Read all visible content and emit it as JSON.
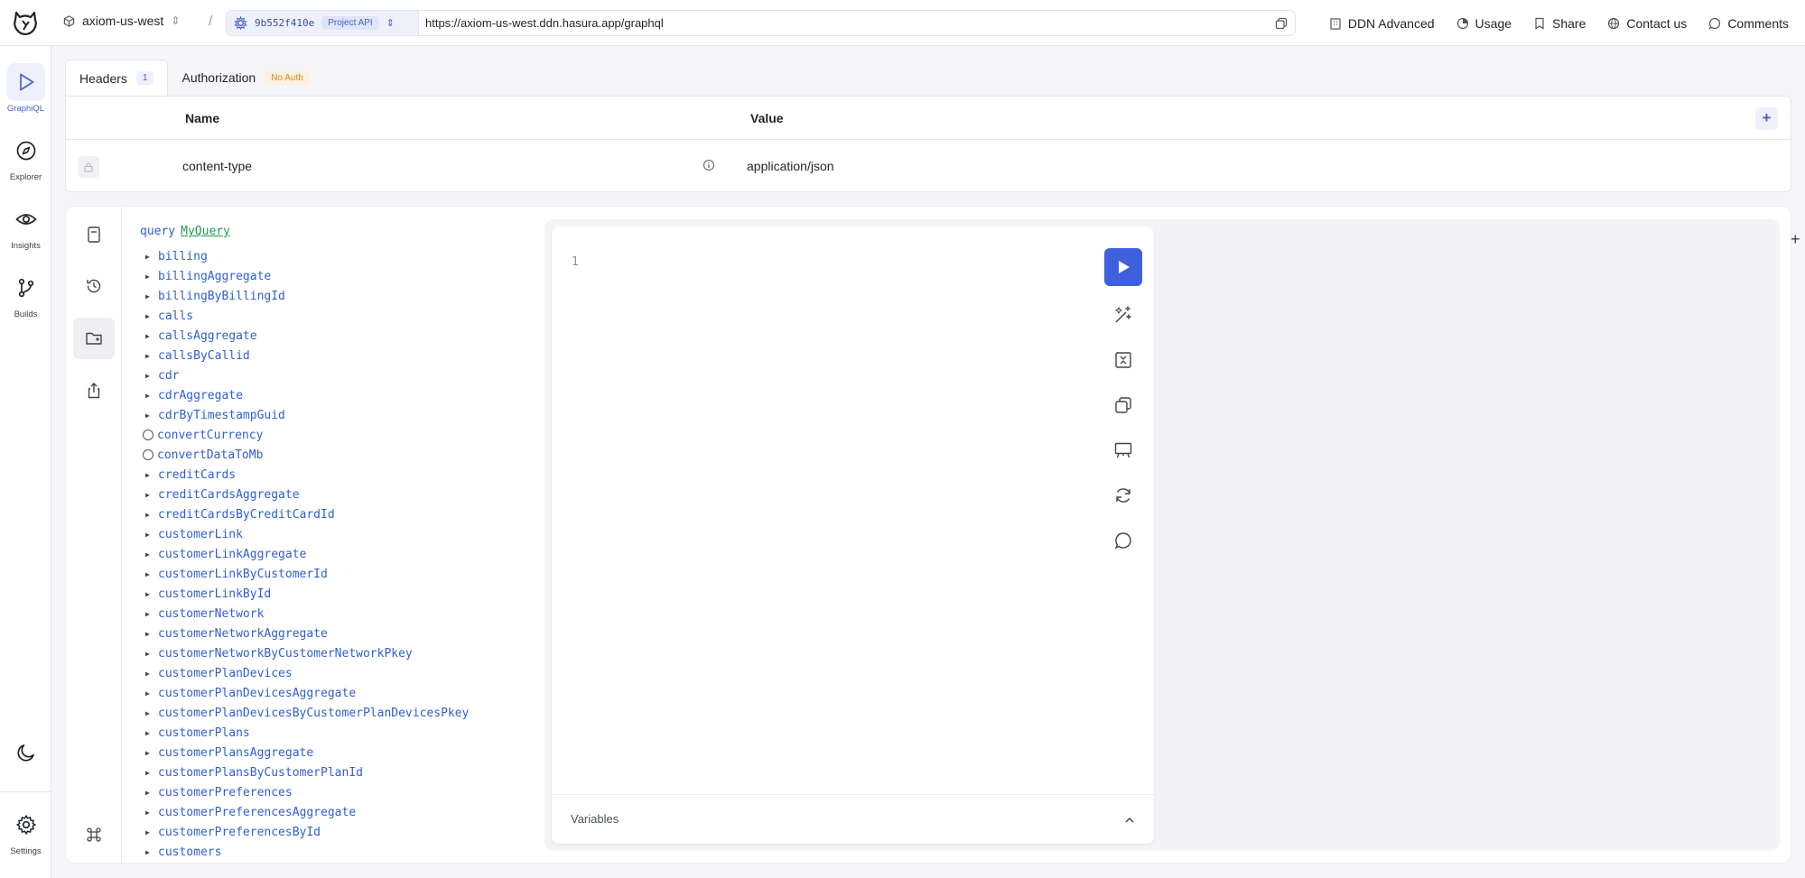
{
  "topbar": {
    "project": "axiom-us-west",
    "build_hash": "9b552f410e",
    "api_badge": "Project API",
    "url": "https://axiom-us-west.ddn.hasura.app/graphql",
    "actions": {
      "ddn": "DDN Advanced",
      "usage": "Usage",
      "share": "Share",
      "contact": "Contact us",
      "comments": "Comments"
    }
  },
  "rail": {
    "graphiql": "GraphiQL",
    "explorer": "Explorer",
    "insights": "Insights",
    "builds": "Builds",
    "settings": "Settings"
  },
  "headers": {
    "tab_headers": "Headers",
    "tab_headers_count": "1",
    "tab_auth": "Authorization",
    "auth_badge": "No Auth",
    "col_name": "Name",
    "col_value": "Value",
    "add": "+",
    "row_name": "content-type",
    "row_value": "application/json"
  },
  "explorer": {
    "keyword": "query",
    "name": "MyQuery",
    "fields": [
      {
        "name": "billing",
        "kind": "arrow"
      },
      {
        "name": "billingAggregate",
        "kind": "arrow"
      },
      {
        "name": "billingByBillingId",
        "kind": "arrow"
      },
      {
        "name": "calls",
        "kind": "arrow"
      },
      {
        "name": "callsAggregate",
        "kind": "arrow"
      },
      {
        "name": "callsByCallid",
        "kind": "arrow"
      },
      {
        "name": "cdr",
        "kind": "arrow"
      },
      {
        "name": "cdrAggregate",
        "kind": "arrow"
      },
      {
        "name": "cdrByTimestampGuid",
        "kind": "arrow"
      },
      {
        "name": "convertCurrency",
        "kind": "circle"
      },
      {
        "name": "convertDataToMb",
        "kind": "circle"
      },
      {
        "name": "creditCards",
        "kind": "arrow"
      },
      {
        "name": "creditCardsAggregate",
        "kind": "arrow"
      },
      {
        "name": "creditCardsByCreditCardId",
        "kind": "arrow"
      },
      {
        "name": "customerLink",
        "kind": "arrow"
      },
      {
        "name": "customerLinkAggregate",
        "kind": "arrow"
      },
      {
        "name": "customerLinkByCustomerId",
        "kind": "arrow"
      },
      {
        "name": "customerLinkById",
        "kind": "arrow"
      },
      {
        "name": "customerNetwork",
        "kind": "arrow"
      },
      {
        "name": "customerNetworkAggregate",
        "kind": "arrow"
      },
      {
        "name": "customerNetworkByCustomerNetworkPkey",
        "kind": "arrow"
      },
      {
        "name": "customerPlanDevices",
        "kind": "arrow"
      },
      {
        "name": "customerPlanDevicesAggregate",
        "kind": "arrow"
      },
      {
        "name": "customerPlanDevicesByCustomerPlanDevicesPkey",
        "kind": "arrow"
      },
      {
        "name": "customerPlans",
        "kind": "arrow"
      },
      {
        "name": "customerPlansAggregate",
        "kind": "arrow"
      },
      {
        "name": "customerPlansByCustomerPlanId",
        "kind": "arrow"
      },
      {
        "name": "customerPreferences",
        "kind": "arrow"
      },
      {
        "name": "customerPreferencesAggregate",
        "kind": "arrow"
      },
      {
        "name": "customerPreferencesById",
        "kind": "arrow"
      },
      {
        "name": "customers",
        "kind": "arrow"
      }
    ]
  },
  "editor": {
    "line_number": "1",
    "variables_label": "Variables",
    "add_tab": "+"
  }
}
